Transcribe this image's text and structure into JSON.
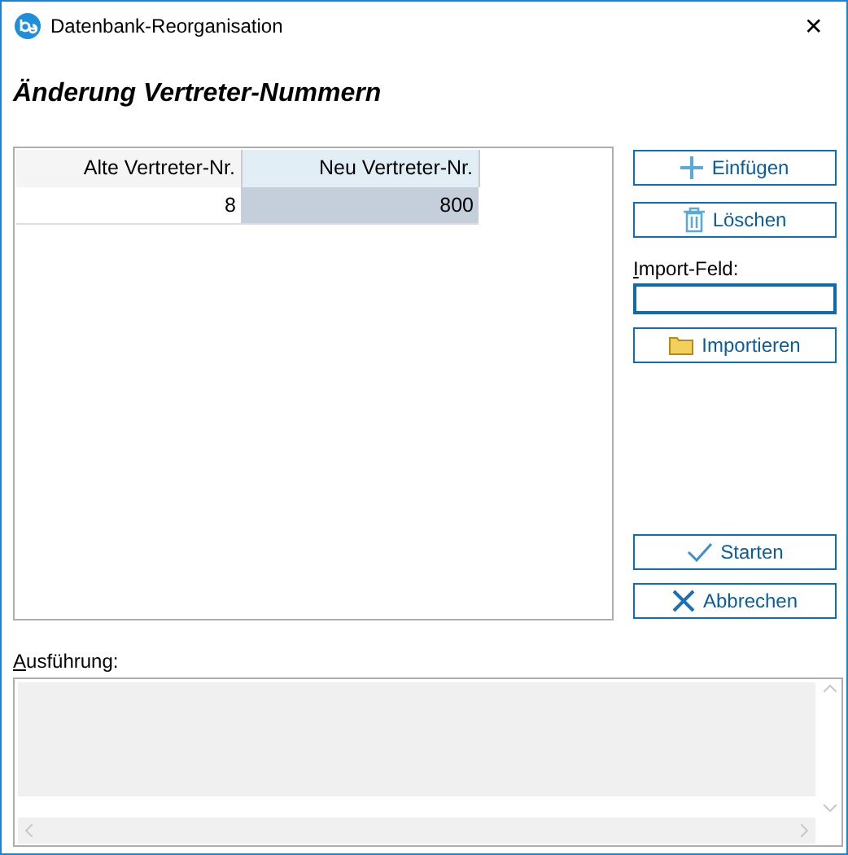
{
  "window": {
    "title": "Datenbank-Reorganisation",
    "close": "✕"
  },
  "heading": "Änderung Vertreter-Nummern",
  "table": {
    "columns": [
      {
        "label": "Alte Vertreter-Nr.",
        "selected": false
      },
      {
        "label": "Neu Vertreter-Nr.",
        "selected": true
      }
    ],
    "rows": [
      {
        "cells": [
          {
            "text": "8",
            "selected": false
          },
          {
            "text": "800",
            "selected": true
          }
        ]
      }
    ]
  },
  "actions": [
    {
      "kind": "plus",
      "label": "Einfügen"
    },
    {
      "kind": "trash",
      "label": "Löschen"
    }
  ],
  "import": {
    "label": "Import-Feld:",
    "button": "Importieren"
  },
  "footer_buttons": [
    {
      "kind": "check",
      "label": "Starten"
    },
    {
      "kind": "cross",
      "label": "Abbrechen"
    }
  ],
  "output": {
    "label": "Ausführung:"
  }
}
